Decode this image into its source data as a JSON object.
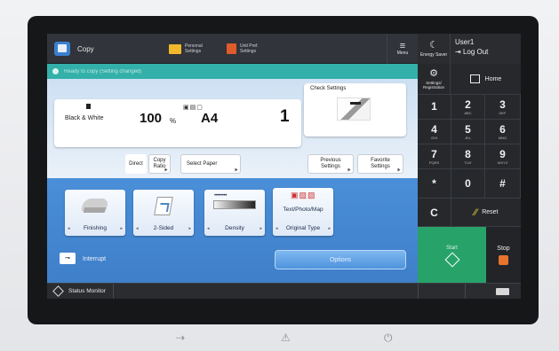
{
  "header": {
    "app_label": "Copy",
    "personal_settings": [
      "Personal",
      "Settings"
    ],
    "unit_settings": [
      "Unit Pref.",
      "Settings"
    ],
    "menu_label": "Menu",
    "energy_saver": "Energy Saver",
    "user_name": "User1",
    "logout_label": "Log Out"
  },
  "status_strip": {
    "message": "Ready to copy (Setting changed)"
  },
  "copy_settings": {
    "color_mode": "Black & White",
    "ratio_value": "100",
    "ratio_unit": "%",
    "paper_size": "A4",
    "quantity": "1",
    "check_settings_label": "Check Settings",
    "direct_label": "Direct",
    "copy_ratio_label": [
      "Copy",
      "Ratio"
    ],
    "select_paper_label": "Select Paper",
    "previous_settings_label": [
      "Previous",
      "Settings"
    ],
    "favorite_settings_label": [
      "Favorite",
      "Settings"
    ]
  },
  "functions": {
    "finishing": "Finishing",
    "two_sided": "2-Sided",
    "density": "Density",
    "original_type_caption": "Text/Photo/Map",
    "original_type": "Original Type",
    "interrupt": "Interrupt",
    "options": "Options"
  },
  "keypad": {
    "settings_registration": [
      "Settings/",
      "Registration"
    ],
    "home": "Home",
    "keys": [
      {
        "n": "1",
        "s": ""
      },
      {
        "n": "2",
        "s": "ABC"
      },
      {
        "n": "3",
        "s": "DEF"
      },
      {
        "n": "4",
        "s": "GHI"
      },
      {
        "n": "5",
        "s": "JKL"
      },
      {
        "n": "6",
        "s": "MNO"
      },
      {
        "n": "7",
        "s": "PQRS"
      },
      {
        "n": "8",
        "s": "TUV"
      },
      {
        "n": "9",
        "s": "WXYZ"
      },
      {
        "n": "*",
        "s": ""
      },
      {
        "n": "0",
        "s": ""
      },
      {
        "n": "#",
        "s": ""
      },
      {
        "n": "C",
        "s": ""
      }
    ],
    "reset": "Reset",
    "start": "Start",
    "stop": "Stop"
  },
  "status_bar": {
    "status_monitor": "Status Monitor"
  },
  "colors": {
    "strip": "#32b0a9",
    "function_area": "#4a8fd8",
    "start": "#27a36a",
    "stop_icon": "#e8732f"
  }
}
